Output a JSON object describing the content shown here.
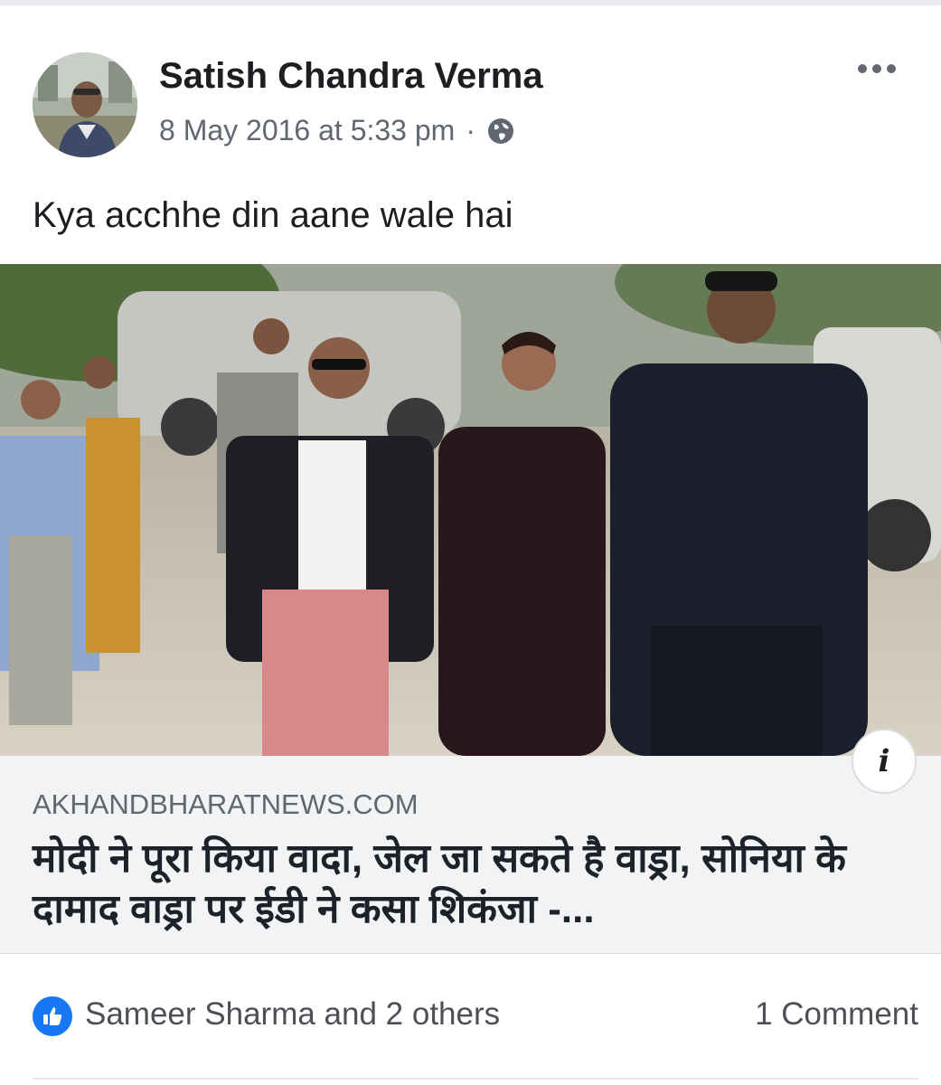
{
  "post": {
    "author": "Satish Chandra Verma",
    "timestamp": "8 May 2016 at 5:33 pm",
    "separator": "·",
    "privacy_icon": "globe-icon",
    "more_icon": "more-options-icon",
    "text": "Kya acchhe din aane wale hai"
  },
  "link_preview": {
    "domain": "AKHANDBHARATNEWS.COM",
    "title": "मोदी ने पूरा किया वादा, जेल जा सकते है वाड्रा, सोनिया के दामाद वाड्रा पर ईडी ने कसा शिकंजा -...",
    "info_label": "i"
  },
  "reactions": {
    "icon": "like-icon",
    "likers": "Sameer Sharma and 2 others",
    "comments": "1 Comment"
  },
  "colors": {
    "accent": "#1877f2",
    "secondary_text": "#606770",
    "preview_bg": "#f2f3f5"
  }
}
